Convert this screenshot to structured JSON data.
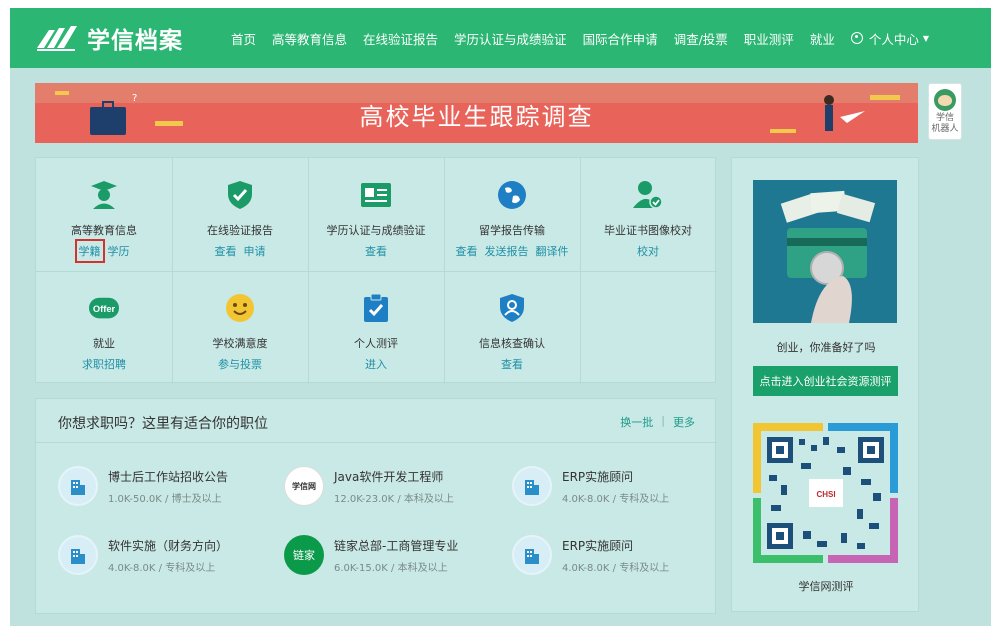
{
  "header": {
    "logo_text": "学信档案",
    "nav": [
      "首页",
      "高等教育信息",
      "在线验证报告",
      "学历认证与成绩验证",
      "国际合作申请",
      "调查/投票",
      "职业测评",
      "就业"
    ],
    "user_menu": "个人中心"
  },
  "banner": {
    "title": "高校毕业生跟踪调查"
  },
  "robot": {
    "label_line1": "学信",
    "label_line2": "机器人"
  },
  "services": [
    {
      "title": "高等教育信息",
      "links": [
        "学籍",
        "学历"
      ],
      "icon": "graduate-icon"
    },
    {
      "title": "在线验证报告",
      "links": [
        "查看",
        "申请"
      ],
      "icon": "shield-check-icon"
    },
    {
      "title": "学历认证与成绩验证",
      "links": [
        "查看"
      ],
      "icon": "id-card-icon"
    },
    {
      "title": "留学报告传输",
      "links": [
        "查看",
        "发送报告",
        "翻译件"
      ],
      "icon": "globe-icon"
    },
    {
      "title": "毕业证书图像校对",
      "links": [
        "校对"
      ],
      "icon": "user-check-icon"
    },
    {
      "title": "就业",
      "links": [
        "求职招聘"
      ],
      "icon": "offer-icon"
    },
    {
      "title": "学校满意度",
      "links": [
        "参与投票"
      ],
      "icon": "smiley-icon"
    },
    {
      "title": "个人测评",
      "links": [
        "进入"
      ],
      "icon": "clipboard-check-icon"
    },
    {
      "title": "信息核查确认",
      "links": [
        "查看"
      ],
      "icon": "user-shield-icon"
    }
  ],
  "jobs": {
    "title": "你想求职吗？这里有适合你的职位",
    "refresh": "换一批",
    "more": "更多",
    "items": [
      {
        "name": "博士后工作站招收公告",
        "meta": "1.0K-50.0K / 博士及以上",
        "logo": "building-icon"
      },
      {
        "name": "Java软件开发工程师",
        "meta": "12.0K-23.0K / 本科及以上",
        "logo": "xuexin-logo"
      },
      {
        "name": "ERP实施顾问",
        "meta": "4.0K-8.0K / 专科及以上",
        "logo": "building-icon"
      },
      {
        "name": "软件实施（财务方向）",
        "meta": "4.0K-8.0K / 专科及以上",
        "logo": "building-icon"
      },
      {
        "name": "链家总部-工商管理专业",
        "meta": "6.0K-15.0K / 本科及以上",
        "logo": "lianjia-logo"
      },
      {
        "name": "ERP实施顾问",
        "meta": "4.0K-8.0K / 专科及以上",
        "logo": "building-icon"
      }
    ],
    "lianjia_text": "链家",
    "xuexin_text": "学信网"
  },
  "sidebar": {
    "ad_caption": "创业，你准备好了吗",
    "ad_button": "点击进入创业社会资源测评",
    "qr_caption": "学信网测评",
    "qr_logo_text": "CHSI"
  }
}
